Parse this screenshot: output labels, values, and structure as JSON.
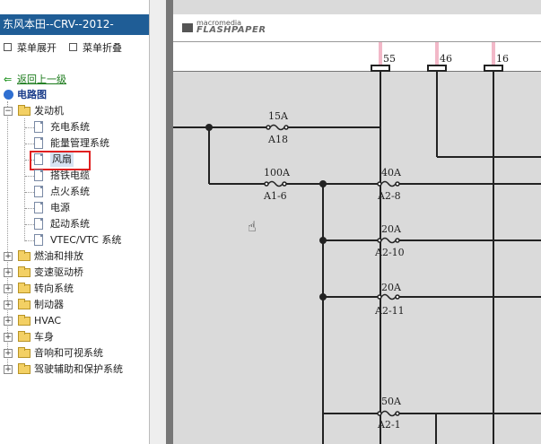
{
  "window_title": "东风本田--CRV--2012-",
  "toolbar": {
    "expand_label": "菜单展开",
    "collapse_label": "菜单折叠"
  },
  "nav": {
    "back_label": "返回上一级"
  },
  "tree": {
    "root_label": "电路图",
    "engine": {
      "label": "发动机",
      "children": [
        "充电系统",
        "能量管理系统",
        "风扇",
        "搭铁电缆",
        "点火系统",
        "电源",
        "起动系统",
        "VTEC/VTC 系统"
      ],
      "selected_index": 2
    },
    "folders": [
      "燃油和排放",
      "变速驱动桥",
      "转向系统",
      "制动器",
      "HVAC",
      "车身",
      "音响和可视系统",
      "驾驶辅助和保护系统"
    ]
  },
  "viewer": {
    "brand_small": "macromedia",
    "brand_big": "FLASHPAPER"
  },
  "diagram": {
    "top_connectors": [
      "55",
      "46",
      "16"
    ],
    "fuses": [
      {
        "rating": "15A",
        "name": "A18"
      },
      {
        "rating": "100A",
        "name": "A1-6"
      },
      {
        "rating": "40A",
        "name": "A2-8"
      },
      {
        "rating": "20A",
        "name": "A2-10"
      },
      {
        "rating": "20A",
        "name": "A2-11"
      },
      {
        "rating": "50A",
        "name": "A2-1"
      }
    ]
  },
  "colors": {
    "title_bar": "#1f5d96",
    "selection_outline": "#e02020",
    "back_link": "#1a7a1a",
    "connector_pink": "#f2b8c8"
  }
}
